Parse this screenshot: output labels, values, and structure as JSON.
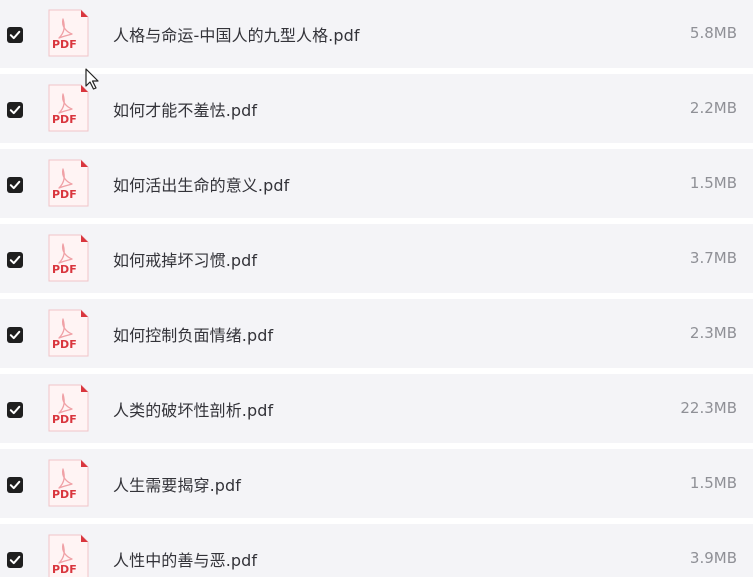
{
  "files": [
    {
      "name": "人格与命运-中国人的九型人格.pdf",
      "size": "5.8MB",
      "checked": true,
      "type_label": "PDF"
    },
    {
      "name": "如何才能不羞怯.pdf",
      "size": "2.2MB",
      "checked": true,
      "type_label": "PDF"
    },
    {
      "name": "如何活出生命的意义.pdf",
      "size": "1.5MB",
      "checked": true,
      "type_label": "PDF"
    },
    {
      "name": "如何戒掉坏习惯.pdf",
      "size": "3.7MB",
      "checked": true,
      "type_label": "PDF"
    },
    {
      "name": "如何控制负面情绪.pdf",
      "size": "2.3MB",
      "checked": true,
      "type_label": "PDF"
    },
    {
      "name": "人类的破坏性剖析.pdf",
      "size": "22.3MB",
      "checked": true,
      "type_label": "PDF"
    },
    {
      "name": "人生需要揭穿.pdf",
      "size": "1.5MB",
      "checked": true,
      "type_label": "PDF"
    },
    {
      "name": "人性中的善与恶.pdf",
      "size": "3.9MB",
      "checked": true,
      "type_label": "PDF"
    }
  ],
  "icons": {
    "checkbox": "checkmark-icon",
    "file": "pdf-file-icon",
    "cursor": "mouse-pointer-icon"
  },
  "colors": {
    "row_background": "#f4f4f7",
    "separator": "#ffffff",
    "checkbox": "#1f1f1f",
    "pdf_red": "#d9363e",
    "pdf_page": "#fff4f4",
    "filename_text": "#333339",
    "size_text": "#8f9096"
  }
}
